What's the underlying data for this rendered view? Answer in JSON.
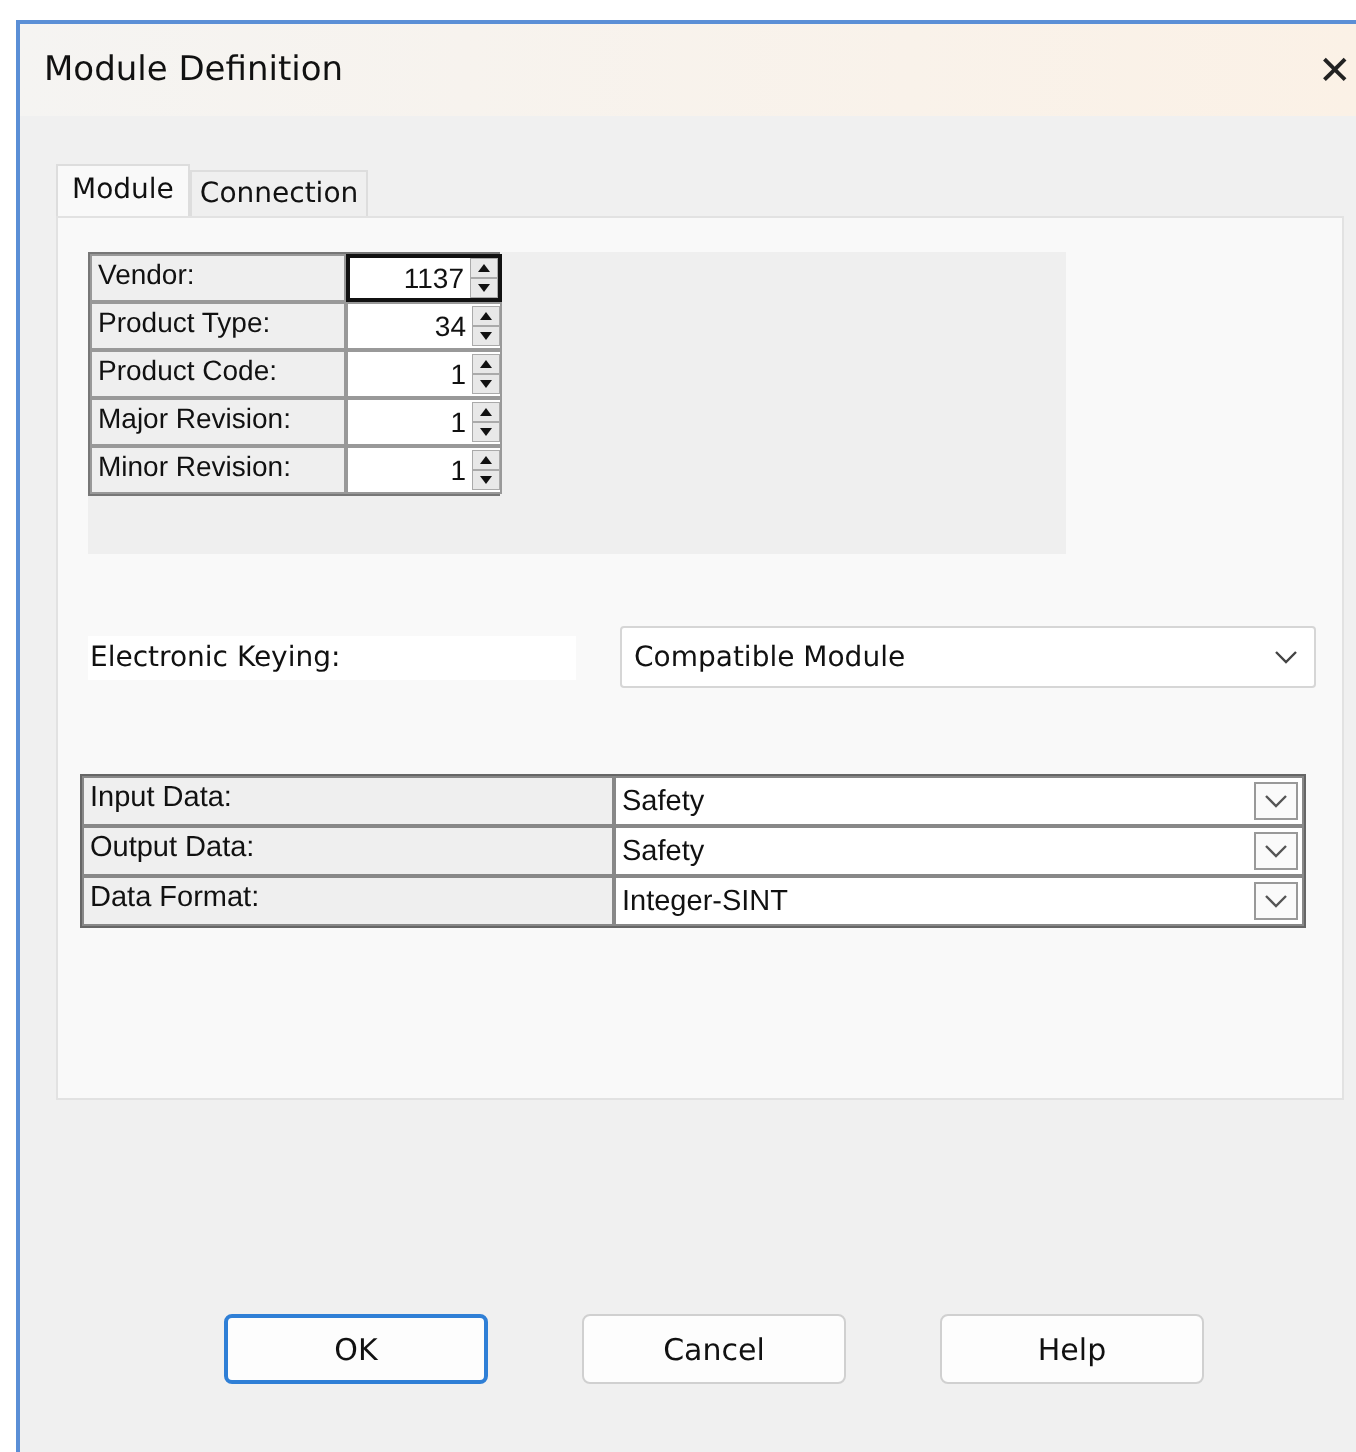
{
  "window": {
    "title": "Module Definition",
    "close": "✕"
  },
  "tabs": [
    {
      "label": "Module",
      "selected": true
    },
    {
      "label": "Connection",
      "selected": false
    }
  ],
  "identity": [
    {
      "label": "Vendor:",
      "value": "1137",
      "focused": true
    },
    {
      "label": "Product Type:",
      "value": "34",
      "focused": false
    },
    {
      "label": "Product Code:",
      "value": "1",
      "focused": false
    },
    {
      "label": "Major Revision:",
      "value": "1",
      "focused": false
    },
    {
      "label": "Minor Revision:",
      "value": "1",
      "focused": false
    }
  ],
  "keying": {
    "label": "Electronic Keying:",
    "value": "Compatible Module"
  },
  "data": [
    {
      "label": "Input Data:",
      "value": "Safety"
    },
    {
      "label": "Output Data:",
      "value": "Safety"
    },
    {
      "label": "Data Format:",
      "value": "Integer-SINT"
    }
  ],
  "buttons": [
    {
      "label": "OK",
      "default": true
    },
    {
      "label": "Cancel",
      "default": false
    },
    {
      "label": "Help",
      "default": false
    }
  ]
}
